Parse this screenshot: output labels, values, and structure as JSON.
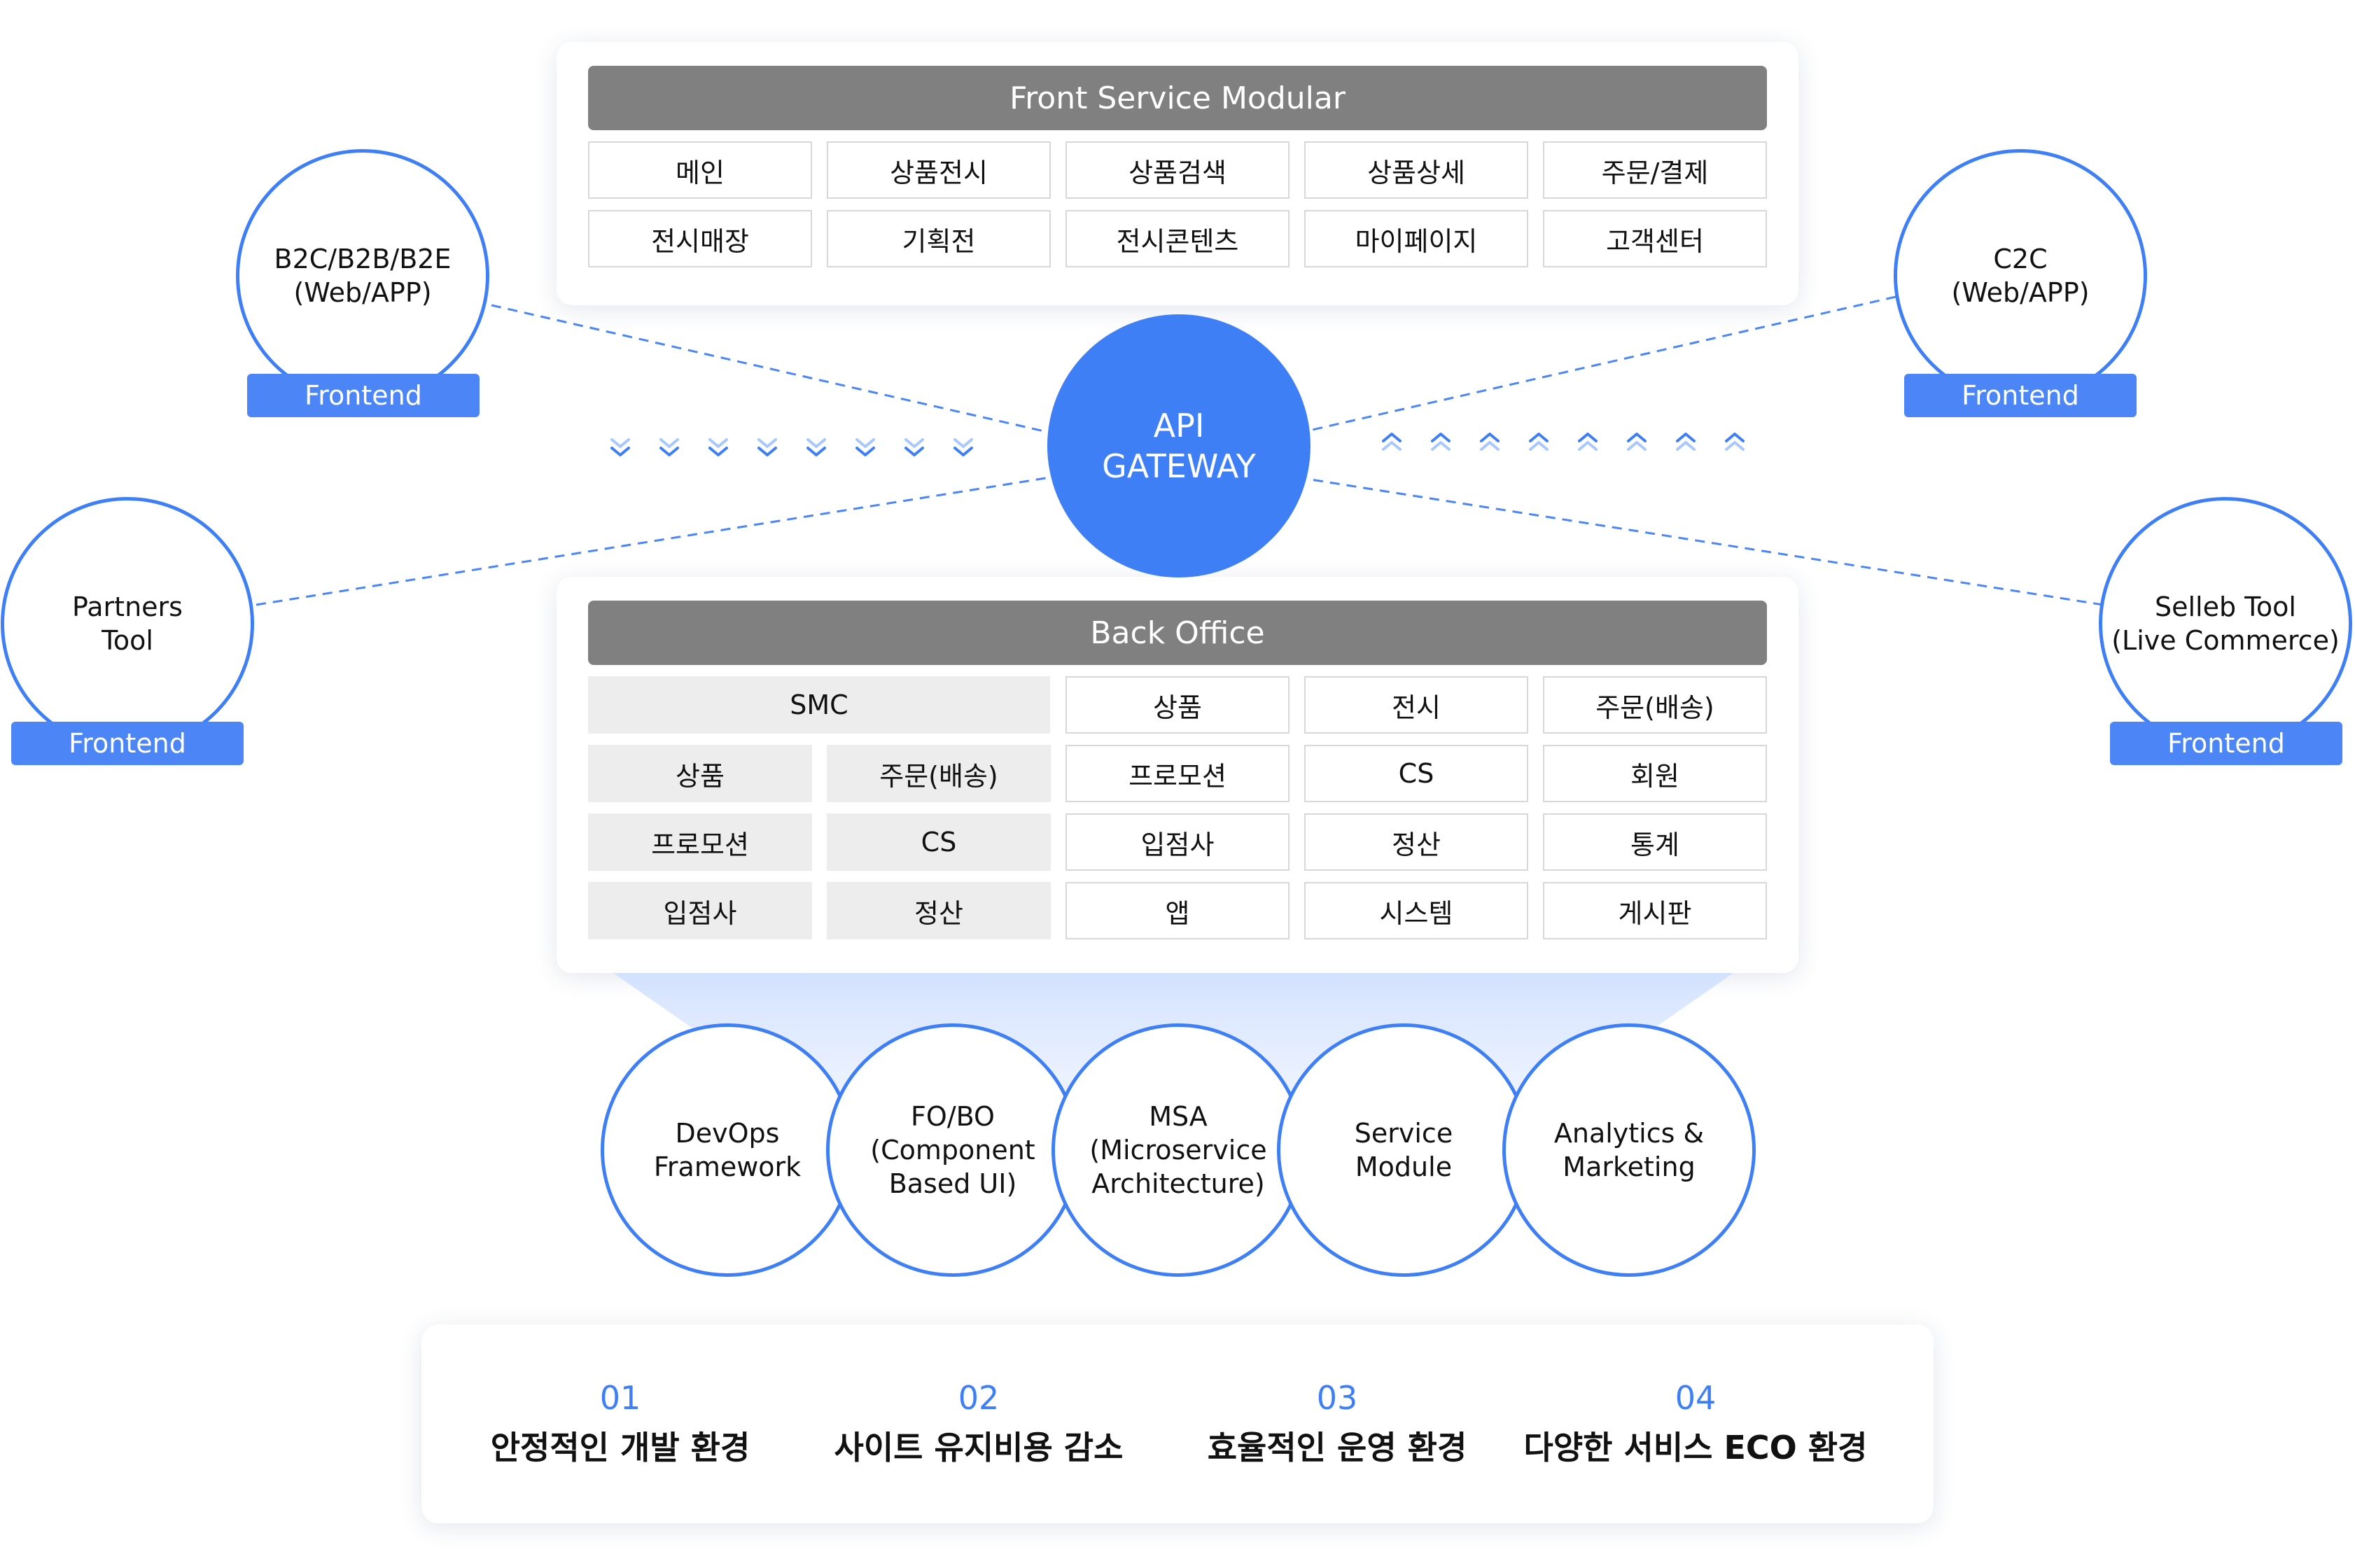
{
  "colors": {
    "accent": "#3f7ff5",
    "header_gray": "#808080",
    "cell_gray": "#ededed"
  },
  "front_panel": {
    "title": "Front Service Modular",
    "rows": [
      [
        "메인",
        "상품전시",
        "상품검색",
        "상품상세",
        "주문/결제"
      ],
      [
        "전시매장",
        "기획전",
        "전시콘텐츠",
        "마이페이지",
        "고객센터"
      ]
    ]
  },
  "gateway": {
    "line1": "API",
    "line2": "GATEWAY"
  },
  "back_panel": {
    "title": "Back Office",
    "smc_label": "SMC",
    "smc_rows": [
      [
        "상품",
        "주문(배송)"
      ],
      [
        "프로모션",
        "CS"
      ],
      [
        "입점사",
        "정산"
      ]
    ],
    "right_rows": [
      [
        "상품",
        "전시",
        "주문(배송)"
      ],
      [
        "프로모션",
        "CS",
        "회원"
      ],
      [
        "입점사",
        "정산",
        "통계"
      ],
      [
        "앱",
        "시스템",
        "게시판"
      ]
    ]
  },
  "clients": [
    {
      "label": "B2C/B2B/B2E\n(Web/APP)",
      "tag": "Frontend"
    },
    {
      "label": "C2C\n(Web/APP)",
      "tag": "Frontend"
    },
    {
      "label": "Partners\nTool",
      "tag": "Frontend"
    },
    {
      "label": "Selleb Tool\n(Live Commerce)",
      "tag": "Frontend"
    }
  ],
  "features": [
    "DevOps\nFramework",
    "FO/BO\n(Component\nBased UI)",
    "MSA\n(Microservice\nArchitecture)",
    "Service\nModule",
    "Analytics &\nMarketing"
  ],
  "benefits": [
    {
      "num": "01",
      "text": "안정적인 개발 환경"
    },
    {
      "num": "02",
      "text": "사이트 유지비용 감소"
    },
    {
      "num": "03",
      "text": "효율적인 운영 환경"
    },
    {
      "num": "04",
      "text": "다양한 서비스 ECO 환경"
    }
  ]
}
